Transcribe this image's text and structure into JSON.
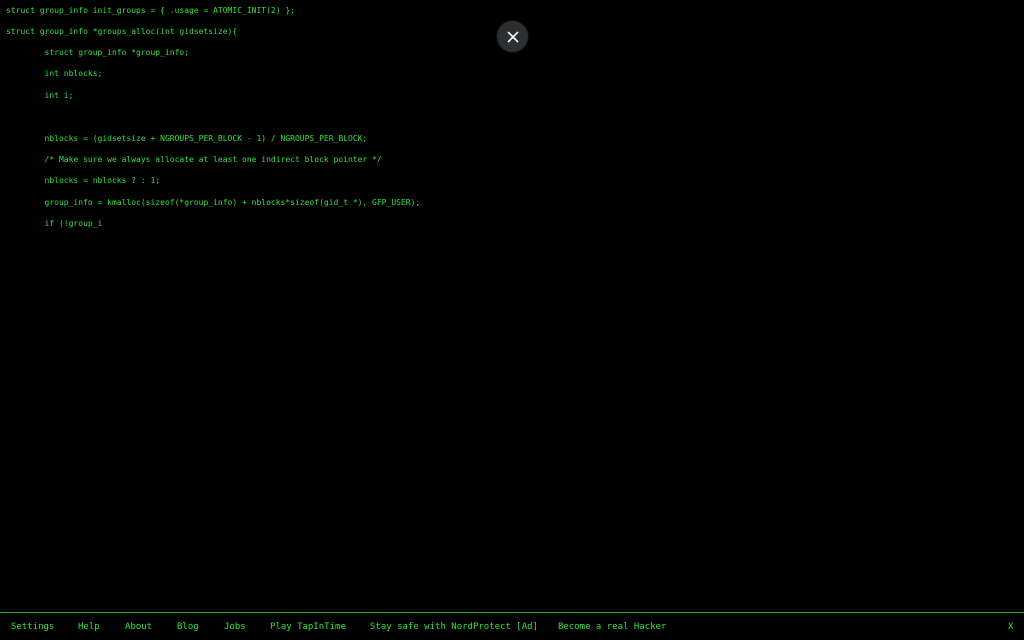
{
  "code": {
    "lines": [
      "struct group_info init_groups = { .usage = ATOMIC_INIT(2) };",
      "struct group_info *groups_alloc(int gidsetsize){",
      "        struct group_info *group_info;",
      "        int nblocks;",
      "        int i;",
      "        nblocks = (gidsetsize + NGROUPS_PER_BLOCK - 1) / NGROUPS_PER_BLOCK;",
      "        /* Make sure we always allocate at least one indirect block pointer */",
      "        nblocks = nblocks ? : 1;",
      "        group_info = kmalloc(sizeof(*group_info) + nblocks*sizeof(gid_t *), GFP_USER);",
      "        if (!group_i"
    ]
  },
  "overlay": {
    "close_icon": "close-icon"
  },
  "footer": {
    "links": [
      "Settings",
      "Help",
      "About",
      "Blog",
      "Jobs",
      "Play TapInTime",
      "Stay safe with NordProtect [Ad]",
      "Become a real Hacker"
    ],
    "close_label": "X"
  },
  "colors": {
    "text": "#33e040",
    "background": "#000000",
    "overlay_button": "#2b2f33",
    "footer_border": "#1faa2a"
  }
}
